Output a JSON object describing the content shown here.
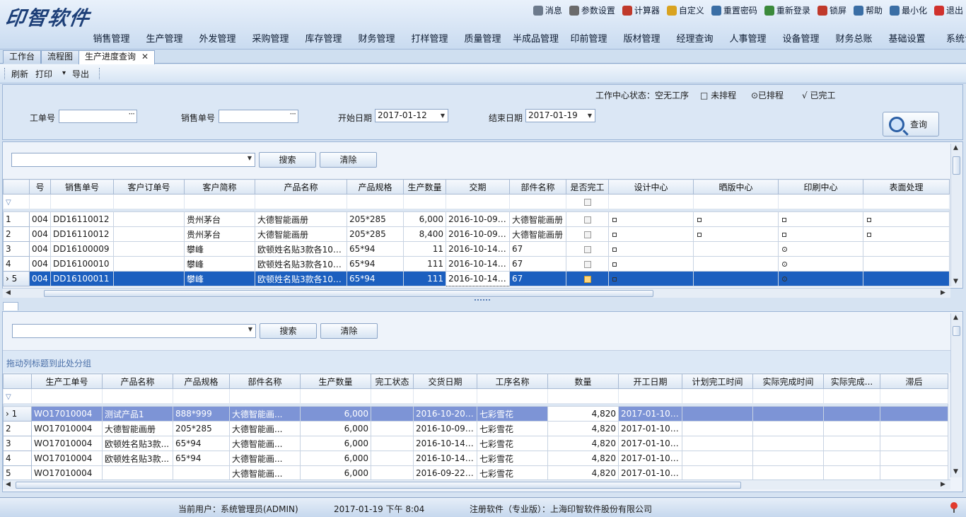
{
  "app": {
    "logo_text": "印智软件"
  },
  "top_actions": [
    {
      "label": "消息",
      "icon": "flag-icon",
      "color": "#6c7a8c"
    },
    {
      "label": "参数设置",
      "icon": "gear-icon",
      "color": "#6b6b6b"
    },
    {
      "label": "计算器",
      "icon": "calculator-icon",
      "color": "#c0392b"
    },
    {
      "label": "自定义",
      "icon": "clipboard-icon",
      "color": "#d9a320"
    },
    {
      "label": "重置密码",
      "icon": "search-key-icon",
      "color": "#3a6ea5"
    },
    {
      "label": "重新登录",
      "icon": "users-icon",
      "color": "#3b8a3b"
    },
    {
      "label": "锁屏",
      "icon": "lock-icon",
      "color": "#c0392b"
    },
    {
      "label": "帮助",
      "icon": "help-icon",
      "color": "#3a6ea5"
    },
    {
      "label": "最小化",
      "icon": "minimize-icon",
      "color": "#3a6ea5"
    },
    {
      "label": "退出",
      "icon": "exit-icon",
      "color": "#d0312d"
    }
  ],
  "menu": [
    "销售管理",
    "生产管理",
    "外发管理",
    "采购管理",
    "库存管理",
    "财务管理",
    "打样管理",
    "质量管理",
    "半成品管理",
    "印前管理",
    "版材管理",
    "经理查询",
    "人事管理",
    "设备管理",
    "财务总账",
    "基础设置",
    "系统设"
  ],
  "tabs": [
    {
      "label": "工作台"
    },
    {
      "label": "流程图"
    },
    {
      "label": "生产进度查询",
      "close": "✕"
    }
  ],
  "toolbar": {
    "refresh": "刷新",
    "print": "打印",
    "export": "导出",
    "dropdown": "▾"
  },
  "filter": {
    "workorder_label": "工单号",
    "workorder_value": "",
    "salesorder_label": "销售单号",
    "salesorder_value": "",
    "start_label": "开始日期",
    "start_value": "2017-01-12",
    "end_label": "结束日期",
    "end_value": "2017-01-19",
    "dots": "···",
    "status_label": "工作中心状态：空无工序",
    "status_unscheduled": "□ 未排程",
    "status_scheduled": "⊙已排程",
    "status_done": "√ 已完工",
    "query_button": "查询"
  },
  "upper": {
    "search_button": "搜索",
    "clear_button": "清除",
    "columns": [
      "号",
      "销售单号",
      "客户订单号",
      "客户简称",
      "产品名称",
      "产品规格",
      "生产数量",
      "交期",
      "部件名称",
      "是否完工",
      "设计中心",
      "晒版中心",
      "印刷中心",
      "表面处理"
    ],
    "rows": [
      {
        "n": "1",
        "id": "004",
        "so": "DD16110012",
        "po": "",
        "cust": "贵州茅台",
        "prod": "大德智能画册",
        "spec": "205*285",
        "qty": "6,000",
        "due": "2016-10-09 ...",
        "part": "大德智能画册",
        "design": "sq",
        "plate": "sq",
        "print": "sq",
        "surface": "sq"
      },
      {
        "n": "2",
        "id": "004",
        "so": "DD16110012",
        "po": "",
        "cust": "贵州茅台",
        "prod": "大德智能画册",
        "spec": "205*285",
        "qty": "8,400",
        "due": "2016-10-09 ...",
        "part": "大德智能画册",
        "design": "sq",
        "plate": "sq",
        "print": "sq",
        "surface": "sq"
      },
      {
        "n": "3",
        "id": "004",
        "so": "DD16100009",
        "po": "",
        "cust": "攀峰",
        "prod": "欧顿姓名贴3款各100...",
        "spec": "65*94",
        "qty": "11",
        "due": "2016-10-14 ...",
        "part": "67",
        "design": "sq",
        "plate": "",
        "print": "dot",
        "surface": ""
      },
      {
        "n": "4",
        "id": "004",
        "so": "DD16100010",
        "po": "",
        "cust": "攀峰",
        "prod": "欧顿姓名贴3款各100...",
        "spec": "65*94",
        "qty": "111",
        "due": "2016-10-14 ...",
        "part": "67",
        "design": "sq",
        "plate": "",
        "print": "dot",
        "surface": ""
      },
      {
        "n": "5",
        "id": "004",
        "so": "DD16100011",
        "po": "",
        "cust": "攀峰",
        "prod": "欧顿姓名贴3款各100...",
        "spec": "65*94",
        "qty": "111",
        "due": "2016-10-14 ...",
        "part": "67",
        "design": "sq",
        "plate": "",
        "print": "dot",
        "surface": "",
        "selected": true
      }
    ]
  },
  "lower": {
    "search_button": "搜索",
    "clear_button": "清除",
    "group_hint": "拖动列标题到此处分组",
    "columns": [
      "生产工单号",
      "产品名称",
      "产品规格",
      "部件名称",
      "生产数量",
      "完工状态",
      "交货日期",
      "工序名称",
      "数量",
      "开工日期",
      "计划完工时间",
      "实际完成时间",
      "实际完成...",
      "滞后"
    ],
    "rows": [
      {
        "n": "1",
        "wo": "WO17010004",
        "prod": "测试产品1",
        "spec": "888*999",
        "part": "大德智能画...",
        "qty": "6,000",
        "state": "",
        "due": "2016-10-20 ...",
        "proc": "七彩雪花",
        "amount": "4,820",
        "start": "2017-01-10 ...",
        "selected": true
      },
      {
        "n": "2",
        "wo": "WO17010004",
        "prod": "大德智能画册",
        "spec": "205*285",
        "part": "大德智能画...",
        "qty": "6,000",
        "state": "",
        "due": "2016-10-09 ...",
        "proc": "七彩雪花",
        "amount": "4,820",
        "start": "2017-01-10 ..."
      },
      {
        "n": "3",
        "wo": "WO17010004",
        "prod": "欧顿姓名贴3款...",
        "spec": "65*94",
        "part": "大德智能画...",
        "qty": "6,000",
        "state": "",
        "due": "2016-10-14 ...",
        "proc": "七彩雪花",
        "amount": "4,820",
        "start": "2017-01-10 ..."
      },
      {
        "n": "4",
        "wo": "WO17010004",
        "prod": "欧顿姓名贴3款...",
        "spec": "65*94",
        "part": "大德智能画...",
        "qty": "6,000",
        "state": "",
        "due": "2016-10-14 ...",
        "proc": "七彩雪花",
        "amount": "4,820",
        "start": "2017-01-10 ..."
      },
      {
        "n": "5",
        "wo": "WO17010004",
        "prod": "",
        "spec": "",
        "part": "大德智能画...",
        "qty": "6,000",
        "state": "",
        "due": "2016-09-22 ...",
        "proc": "七彩雪花",
        "amount": "4,820",
        "start": "2017-01-10 ..."
      }
    ]
  },
  "status": {
    "user": "当前用户：系统管理员(ADMIN)",
    "datetime": "2017-01-19 下午 8:04",
    "license": "注册软件（专业版）：上海印智软件股份有限公司"
  },
  "colors": {
    "selection": "#1c5fbf",
    "selection_light": "#7d94d6",
    "accent": "#2b5fa5"
  }
}
